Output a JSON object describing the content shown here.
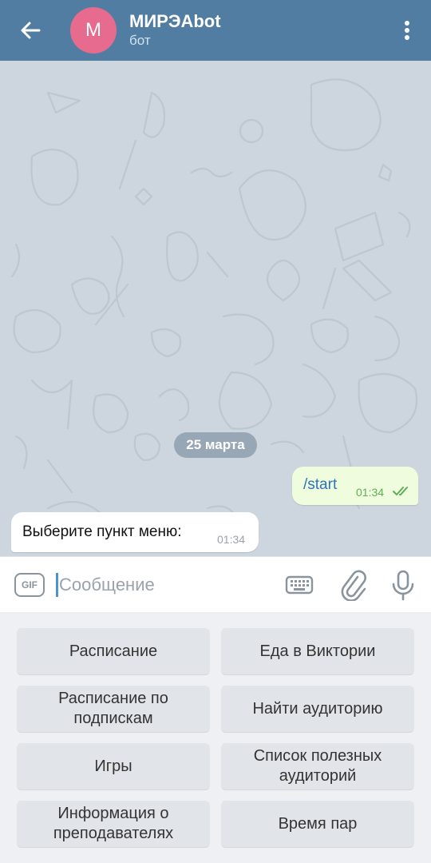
{
  "header": {
    "avatar_letter": "M",
    "title": "МИРЭАbot",
    "subtitle": "бот",
    "bg_color": "#517da2",
    "avatar_color": "#e66b8f"
  },
  "chat": {
    "date": "25 марта",
    "messages": [
      {
        "direction": "out",
        "text": "/start",
        "time": "01:34",
        "status": "read"
      },
      {
        "direction": "in",
        "text": "Выберите пункт меню:",
        "time": "01:34"
      }
    ]
  },
  "composer": {
    "gif_label": "GIF",
    "placeholder": "Сообщение",
    "icons": [
      "keyboard-icon",
      "paperclip-icon",
      "microphone-icon"
    ]
  },
  "bot_keyboard": {
    "buttons": [
      "Расписание",
      "Еда в Виктории",
      "Расписание по подпискам",
      "Найти аудиторию",
      "Игры",
      "Список полезных аудиторий",
      "Информация о преподавателях",
      "Время пар"
    ]
  }
}
